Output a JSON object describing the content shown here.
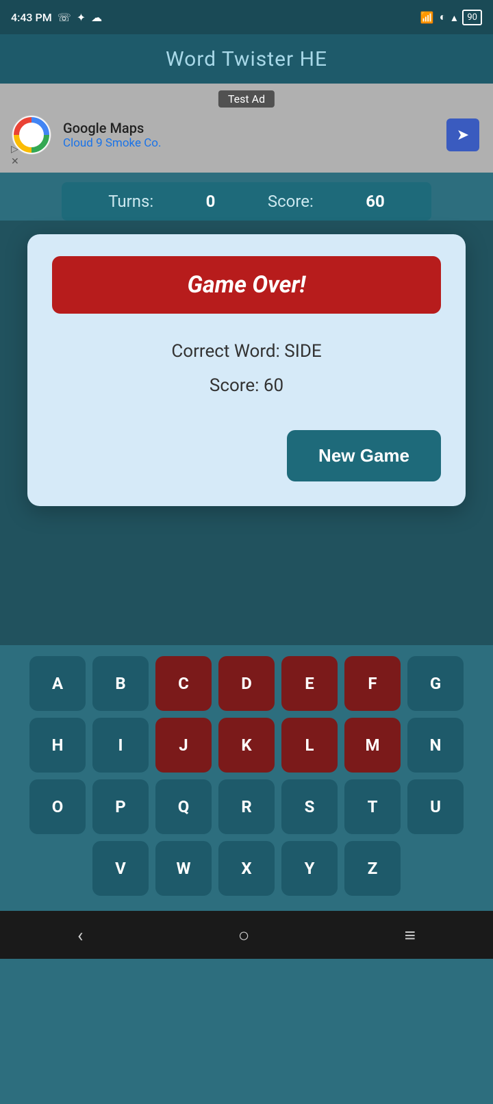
{
  "statusBar": {
    "time": "4:43 PM",
    "battery": "90"
  },
  "header": {
    "title": "Word Twister HE"
  },
  "ad": {
    "label": "Test Ad",
    "company": "Google Maps",
    "subtitle": "Cloud 9 Smoke Co.",
    "playIcon": "▷",
    "closeIcon": "✕"
  },
  "scoreBar": {
    "turnsLabel": "Turns:",
    "turnsValue": "0",
    "scoreLabel": "Score:",
    "scoreValue": "60"
  },
  "dialog": {
    "gameOverLabel": "Game Over!",
    "correctWordLabel": "Correct Word: SIDE",
    "scoreLabel": "Score: 60",
    "newGameLabel": "New Game"
  },
  "keyboard": {
    "rows": [
      [
        "A",
        "B",
        "C",
        "D",
        "E",
        "F",
        "G"
      ],
      [
        "H",
        "I",
        "J",
        "K",
        "L",
        "M",
        "N"
      ],
      [
        "O",
        "P",
        "Q",
        "R",
        "S",
        "T",
        "U"
      ],
      [
        "V",
        "W",
        "X",
        "Y",
        "Z"
      ]
    ],
    "usedKeys": [
      "C",
      "D",
      "E",
      "F",
      "J",
      "K",
      "L",
      "M"
    ]
  },
  "bottomNav": {
    "backIcon": "‹",
    "homeIcon": "○",
    "menuIcon": "≡"
  }
}
